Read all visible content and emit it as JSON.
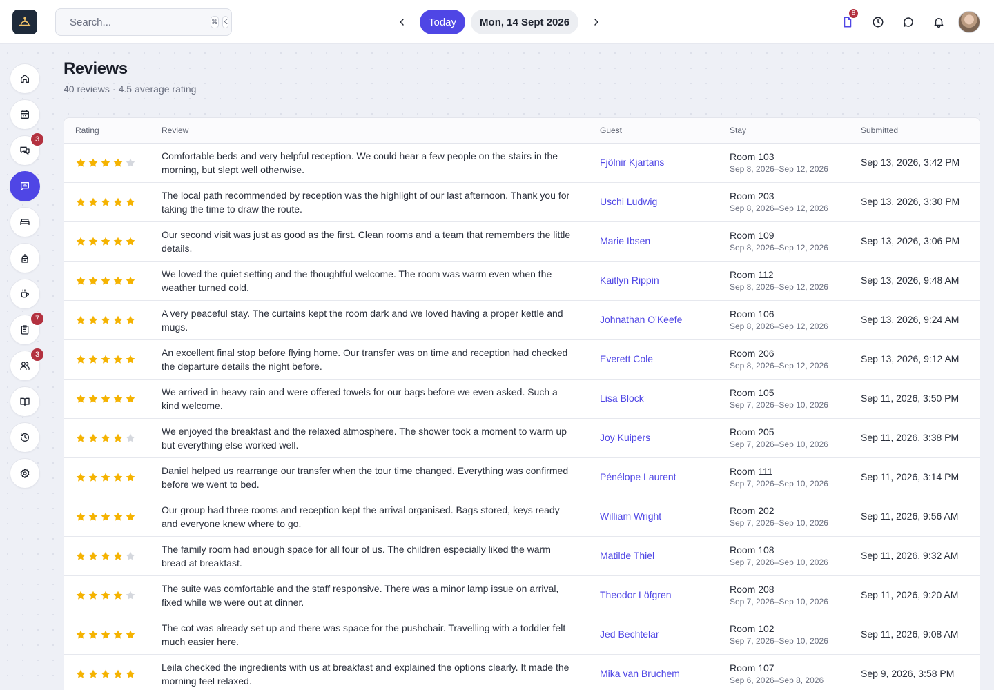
{
  "search": {
    "placeholder": "Search...",
    "kbd1": "⌘",
    "kbd2": "K"
  },
  "datenav": {
    "today_label": "Today",
    "date_label": "Mon, 14 Sept 2026"
  },
  "top_icons": {
    "tasks_badge": "8"
  },
  "sidebar": {
    "messages_badge": "3",
    "tasks_badge": "7",
    "guests_badge": "3"
  },
  "page": {
    "title": "Reviews",
    "review_count": "40 reviews",
    "separator": "·",
    "avg_rating": "4.5 average rating"
  },
  "table": {
    "headers": {
      "rating": "Rating",
      "review": "Review",
      "guest": "Guest",
      "stay": "Stay",
      "submitted": "Submitted"
    },
    "rows": [
      {
        "rating": 4,
        "review": "Comfortable beds and very helpful reception. We could hear a few people on the stairs in the morning, but slept well otherwise.",
        "guest": "Fjölnir Kjartans",
        "room": "Room 103",
        "dates": "Sep 8, 2026–Sep 12, 2026",
        "submitted": "Sep 13, 2026, 3:42 PM"
      },
      {
        "rating": 5,
        "review": "The local path recommended by reception was the highlight of our last afternoon. Thank you for taking the time to draw the route.",
        "guest": "Uschi Ludwig",
        "room": "Room 203",
        "dates": "Sep 8, 2026–Sep 12, 2026",
        "submitted": "Sep 13, 2026, 3:30 PM"
      },
      {
        "rating": 5,
        "review": "Our second visit was just as good as the first. Clean rooms and a team that remembers the little details.",
        "guest": "Marie Ibsen",
        "room": "Room 109",
        "dates": "Sep 8, 2026–Sep 12, 2026",
        "submitted": "Sep 13, 2026, 3:06 PM"
      },
      {
        "rating": 5,
        "review": "We loved the quiet setting and the thoughtful welcome. The room was warm even when the weather turned cold.",
        "guest": "Kaitlyn Rippin",
        "room": "Room 112",
        "dates": "Sep 8, 2026–Sep 12, 2026",
        "submitted": "Sep 13, 2026, 9:48 AM"
      },
      {
        "rating": 5,
        "review": "A very peaceful stay. The curtains kept the room dark and we loved having a proper kettle and mugs.",
        "guest": "Johnathan O'Keefe",
        "room": "Room 106",
        "dates": "Sep 8, 2026–Sep 12, 2026",
        "submitted": "Sep 13, 2026, 9:24 AM"
      },
      {
        "rating": 5,
        "review": "An excellent final stop before flying home. Our transfer was on time and reception had checked the departure details the night before.",
        "guest": "Everett Cole",
        "room": "Room 206",
        "dates": "Sep 8, 2026–Sep 12, 2026",
        "submitted": "Sep 13, 2026, 9:12 AM"
      },
      {
        "rating": 5,
        "review": "We arrived in heavy rain and were offered towels for our bags before we even asked. Such a kind welcome.",
        "guest": "Lisa Block",
        "room": "Room 105",
        "dates": "Sep 7, 2026–Sep 10, 2026",
        "submitted": "Sep 11, 2026, 3:50 PM"
      },
      {
        "rating": 4,
        "review": "We enjoyed the breakfast and the relaxed atmosphere. The shower took a moment to warm up but everything else worked well.",
        "guest": "Joy Kuipers",
        "room": "Room 205",
        "dates": "Sep 7, 2026–Sep 10, 2026",
        "submitted": "Sep 11, 2026, 3:38 PM"
      },
      {
        "rating": 5,
        "review": "Daniel helped us rearrange our transfer when the tour time changed. Everything was confirmed before we went to bed.",
        "guest": "Pénélope Laurent",
        "room": "Room 111",
        "dates": "Sep 7, 2026–Sep 10, 2026",
        "submitted": "Sep 11, 2026, 3:14 PM"
      },
      {
        "rating": 5,
        "review": "Our group had three rooms and reception kept the arrival organised. Bags stored, keys ready and everyone knew where to go.",
        "guest": "William Wright",
        "room": "Room 202",
        "dates": "Sep 7, 2026–Sep 10, 2026",
        "submitted": "Sep 11, 2026, 9:56 AM"
      },
      {
        "rating": 4,
        "review": "The family room had enough space for all four of us. The children especially liked the warm bread at breakfast.",
        "guest": "Matilde Thiel",
        "room": "Room 108",
        "dates": "Sep 7, 2026–Sep 10, 2026",
        "submitted": "Sep 11, 2026, 9:32 AM"
      },
      {
        "rating": 4,
        "review": "The suite was comfortable and the staff responsive. There was a minor lamp issue on arrival, fixed while we were out at dinner.",
        "guest": "Theodor Löfgren",
        "room": "Room 208",
        "dates": "Sep 7, 2026–Sep 10, 2026",
        "submitted": "Sep 11, 2026, 9:20 AM"
      },
      {
        "rating": 5,
        "review": "The cot was already set up and there was space for the pushchair. Travelling with a toddler felt much easier here.",
        "guest": "Jed Bechtelar",
        "room": "Room 102",
        "dates": "Sep 7, 2026–Sep 10, 2026",
        "submitted": "Sep 11, 2026, 9:08 AM"
      },
      {
        "rating": 5,
        "review": "Leila checked the ingredients with us at breakfast and explained the options clearly. It made the morning feel relaxed.",
        "guest": "Mika van Bruchem",
        "room": "Room 107",
        "dates": "Sep 6, 2026–Sep 8, 2026",
        "submitted": "Sep 9, 2026, 3:58 PM"
      }
    ]
  },
  "colors": {
    "accent": "#4f46e5",
    "star_filled": "#f5b301",
    "star_empty": "#d5d8de",
    "badge": "#b3313f"
  }
}
